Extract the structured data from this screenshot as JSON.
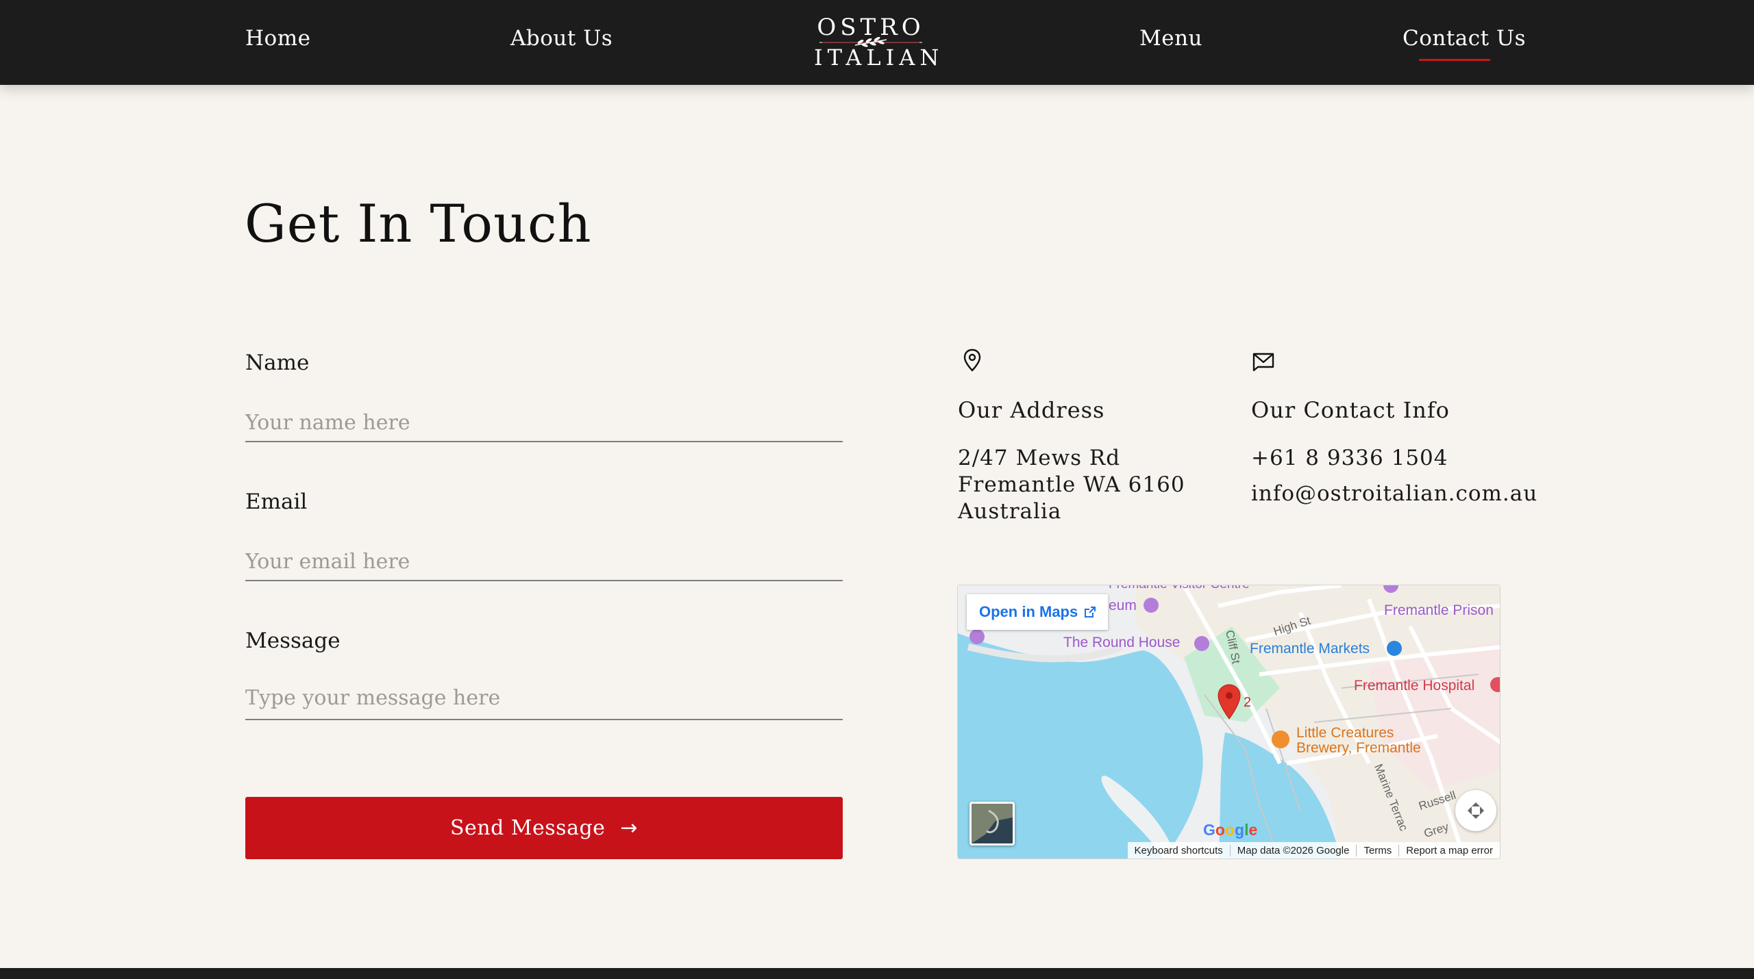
{
  "nav": {
    "home": "Home",
    "about": "About Us",
    "menu": "Menu",
    "contact": "Contact Us",
    "logo_top": "OSTRO",
    "logo_bottom": "ITALIAN",
    "accent_color": "#c8141a"
  },
  "heading": "Get In Touch",
  "form": {
    "name_label": "Name",
    "name_placeholder": "Your name here",
    "email_label": "Email",
    "email_placeholder": "Your email here",
    "message_label": "Message",
    "message_placeholder": "Type your message here",
    "send_label": "Send Message",
    "send_arrow": "→",
    "button_color": "#c8121a"
  },
  "address": {
    "icon": "map-pin-icon",
    "title": "Our Address",
    "line1": "2/47 Mews Rd",
    "line2": "Fremantle WA 6160",
    "line3": "Australia"
  },
  "contact": {
    "icon": "mail-icon",
    "title": "Our Contact Info",
    "phone": "+61 8 9336 1504",
    "email": "info@ostroitalian.com.au"
  },
  "map": {
    "open_label": "Open in Maps",
    "labels": {
      "visitor_centre": "Fremantle Visitor Centre",
      "museum": "eum",
      "prison": "Fremantle Prison",
      "round_house": "The Round House",
      "markets": "Fremantle Markets",
      "hospital": "Fremantle Hospital",
      "brewery_1": "Little Creatures",
      "brewery_2": "Brewery, Fremantle",
      "high_st": "High St",
      "cliff_st": "Cliff St",
      "marine_terrace": "Marine Terrac",
      "russell": "Russell",
      "grey": "Grey",
      "marker_count": "2"
    },
    "google": "Google",
    "footer": {
      "shortcuts": "Keyboard shortcuts",
      "data": "Map data ©2026 Google",
      "terms": "Terms",
      "report": "Report a map error"
    }
  }
}
